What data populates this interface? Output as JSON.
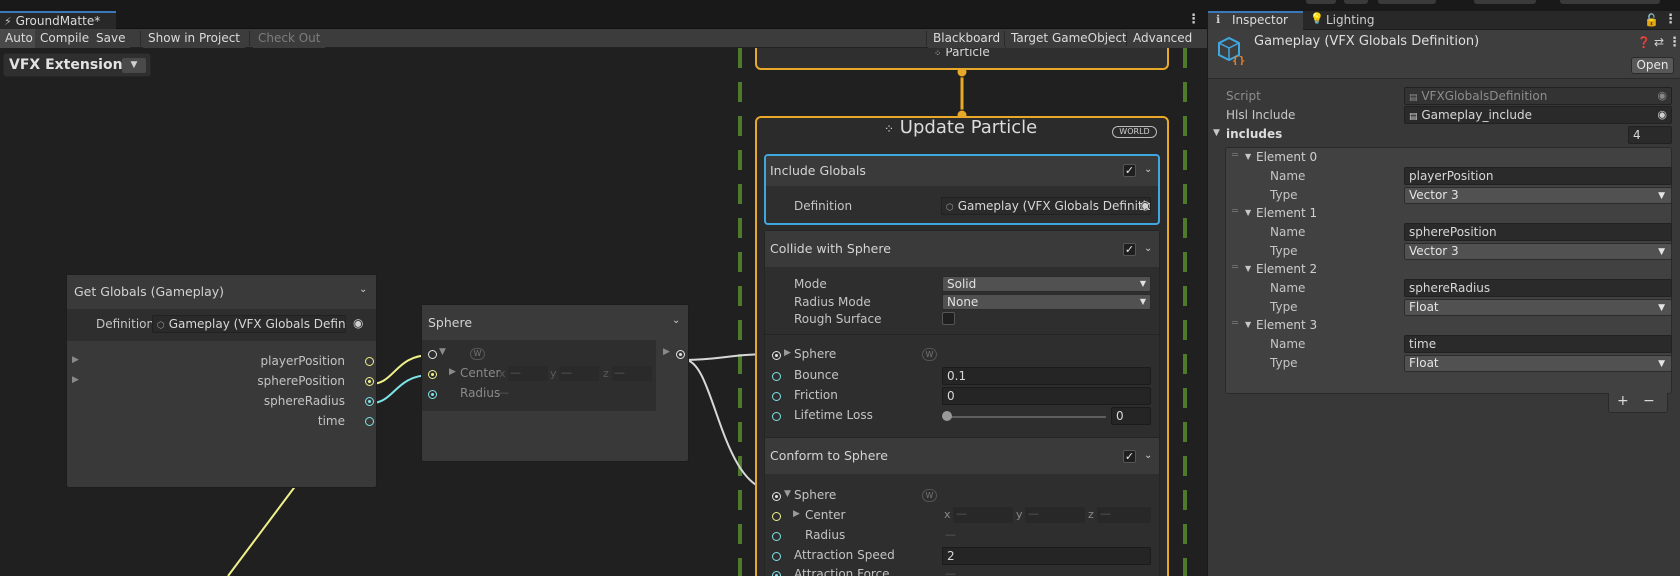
{
  "window": {
    "tab_title": "GroundMatte*",
    "menu_icon": "vertical-ellipsis-icon"
  },
  "toolbar": {
    "auto": "Auto",
    "compile": "Compile",
    "save": "Save",
    "show_in_project": "Show in Project",
    "check_out": "Check Out",
    "blackboard": "Blackboard",
    "target_gameobject": "Target GameObject",
    "advanced": "Advanced"
  },
  "graph": {
    "extension_label": "VFX Extension",
    "particle_label": "Particle",
    "get_globals": {
      "title": "Get Globals (Gameplay)",
      "definition_label": "Definition",
      "definition_value": "Gameplay (VFX Globals Definition)",
      "outputs": [
        "playerPosition",
        "spherePosition",
        "sphereRadius",
        "time"
      ]
    },
    "sphere_node": {
      "title": "Sphere",
      "center": "Center",
      "radius": "Radius",
      "w_badge": "W",
      "x": "x",
      "y": "y",
      "z": "z",
      "dash": "—"
    },
    "update_context": {
      "title": "Update Particle",
      "space_badge": "WORLD",
      "include_globals": {
        "title": "Include Globals",
        "definition_label": "Definition",
        "definition_value": "Gameplay (VFX Globals Definition"
      },
      "collide": {
        "title": "Collide with Sphere",
        "mode_label": "Mode",
        "mode_value": "Solid",
        "radius_mode_label": "Radius Mode",
        "radius_mode_value": "None",
        "rough_label": "Rough Surface",
        "sphere_label": "Sphere",
        "w_badge": "W",
        "bounce_label": "Bounce",
        "bounce_value": "0.1",
        "friction_label": "Friction",
        "friction_value": "0",
        "lifetime_loss_label": "Lifetime Loss",
        "lifetime_loss_value": "0",
        "lifetime_loss_slider": 0
      },
      "conform": {
        "title": "Conform to Sphere",
        "sphere_label": "Sphere",
        "w_badge": "W",
        "center_label": "Center",
        "radius_label": "Radius",
        "attraction_speed_label": "Attraction Speed",
        "attraction_speed_value": "2",
        "attraction_force_label": "Attraction Force",
        "x": "x",
        "y": "y",
        "z": "z",
        "dash": "—"
      }
    }
  },
  "inspector": {
    "tab_inspector": "Inspector",
    "tab_lighting": "Lighting",
    "asset_title": "Gameplay (VFX Globals Definition)",
    "open_button": "Open",
    "script_label": "Script",
    "script_value": "VFXGlobalsDefinition",
    "hlsl_label": "Hlsl Include",
    "hlsl_value": "Gameplay_include",
    "includes_label": "includes",
    "includes_count": "4",
    "name_label": "Name",
    "type_label": "Type",
    "elements": [
      {
        "label": "Element 0",
        "name": "playerPosition",
        "type": "Vector 3"
      },
      {
        "label": "Element 1",
        "name": "spherePosition",
        "type": "Vector 3"
      },
      {
        "label": "Element 2",
        "name": "sphereRadius",
        "type": "Float"
      },
      {
        "label": "Element 3",
        "name": "time",
        "type": "Float"
      }
    ],
    "add": "+",
    "remove": "−"
  },
  "colors": {
    "accent_blue": "#3fa7e0",
    "context_orange": "#e8a82a",
    "flow_green": "#4e7a2c",
    "float_cyan": "#7ee3e6",
    "vector_yellow": "#f1f18c"
  }
}
